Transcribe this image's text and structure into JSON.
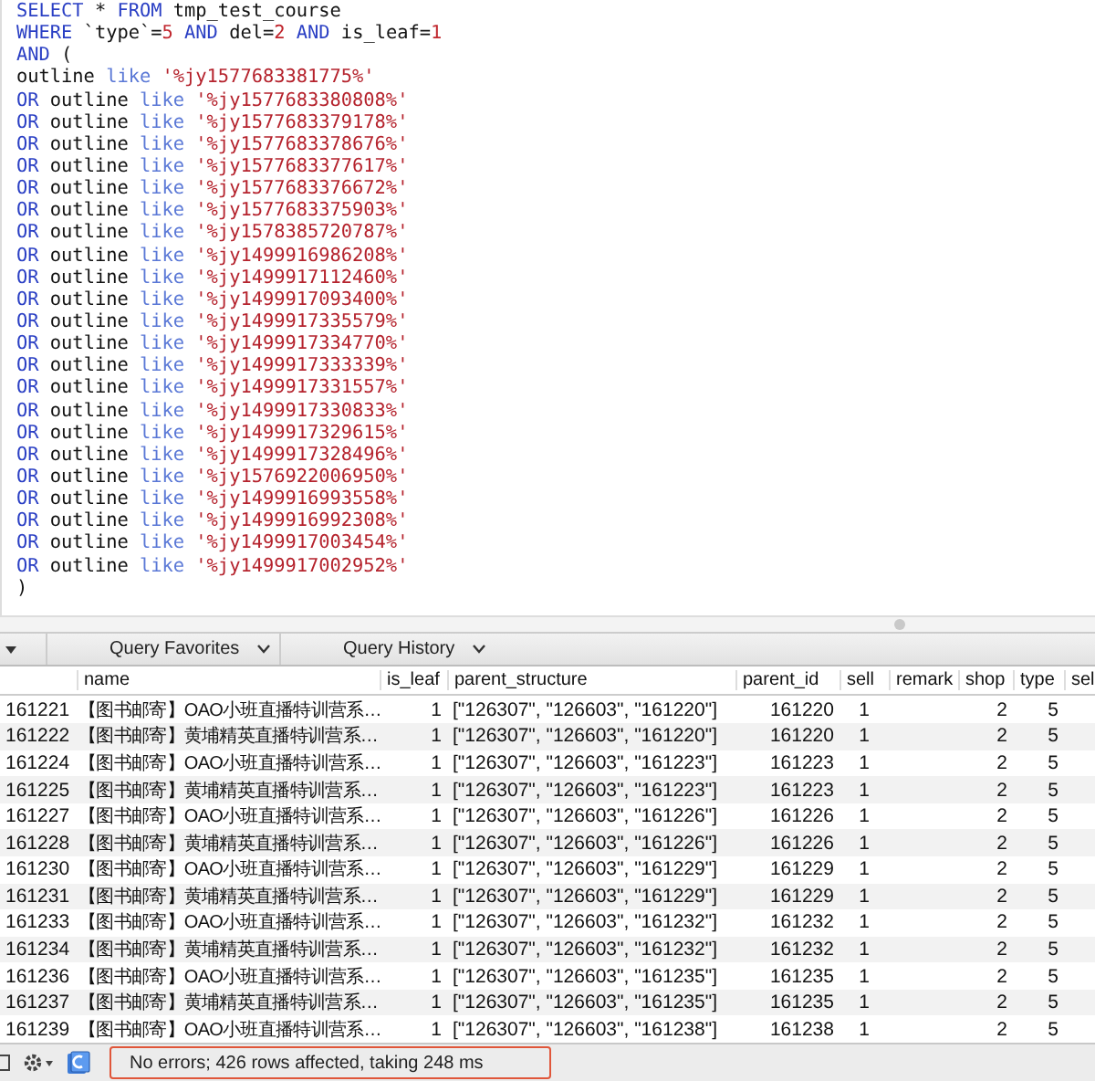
{
  "editor": {
    "lines": [
      [
        {
          "kind": "keyword",
          "text": "SELECT"
        },
        {
          "kind": "plain",
          "text": " * "
        },
        {
          "kind": "keyword",
          "text": "FROM"
        },
        {
          "kind": "plain",
          "text": " tmp_test_course"
        }
      ],
      [
        {
          "kind": "keyword",
          "text": "WHERE"
        },
        {
          "kind": "plain",
          "text": " `type`="
        },
        {
          "kind": "number",
          "text": "5"
        },
        {
          "kind": "keyword",
          "text": " AND"
        },
        {
          "kind": "plain",
          "text": " del="
        },
        {
          "kind": "number",
          "text": "2"
        },
        {
          "kind": "keyword",
          "text": " AND"
        },
        {
          "kind": "plain",
          "text": " is_leaf="
        },
        {
          "kind": "number",
          "text": "1"
        }
      ],
      [
        {
          "kind": "keyword",
          "text": "AND"
        },
        {
          "kind": "plain",
          "text": " ("
        }
      ],
      [
        {
          "kind": "plain",
          "text": "outline "
        },
        {
          "kind": "operator",
          "text": "like"
        },
        {
          "kind": "string",
          "text": " '%jy1577683381775%'"
        }
      ],
      [
        {
          "kind": "keyword",
          "text": "OR"
        },
        {
          "kind": "plain",
          "text": " outline "
        },
        {
          "kind": "operator",
          "text": "like"
        },
        {
          "kind": "string",
          "text": " '%jy1577683380808%'"
        }
      ],
      [
        {
          "kind": "keyword",
          "text": "OR"
        },
        {
          "kind": "plain",
          "text": " outline "
        },
        {
          "kind": "operator",
          "text": "like"
        },
        {
          "kind": "string",
          "text": " '%jy1577683379178%'"
        }
      ],
      [
        {
          "kind": "keyword",
          "text": "OR"
        },
        {
          "kind": "plain",
          "text": " outline "
        },
        {
          "kind": "operator",
          "text": "like"
        },
        {
          "kind": "string",
          "text": " '%jy1577683378676%'"
        }
      ],
      [
        {
          "kind": "keyword",
          "text": "OR"
        },
        {
          "kind": "plain",
          "text": " outline "
        },
        {
          "kind": "operator",
          "text": "like"
        },
        {
          "kind": "string",
          "text": " '%jy1577683377617%'"
        }
      ],
      [
        {
          "kind": "keyword",
          "text": "OR"
        },
        {
          "kind": "plain",
          "text": " outline "
        },
        {
          "kind": "operator",
          "text": "like"
        },
        {
          "kind": "string",
          "text": " '%jy1577683376672%'"
        }
      ],
      [
        {
          "kind": "keyword",
          "text": "OR"
        },
        {
          "kind": "plain",
          "text": " outline "
        },
        {
          "kind": "operator",
          "text": "like"
        },
        {
          "kind": "string",
          "text": " '%jy1577683375903%'"
        }
      ],
      [
        {
          "kind": "keyword",
          "text": "OR"
        },
        {
          "kind": "plain",
          "text": " outline "
        },
        {
          "kind": "operator",
          "text": "like"
        },
        {
          "kind": "string",
          "text": " '%jy1578385720787%'"
        }
      ],
      [
        {
          "kind": "keyword",
          "text": "OR"
        },
        {
          "kind": "plain",
          "text": " outline "
        },
        {
          "kind": "operator",
          "text": "like"
        },
        {
          "kind": "string",
          "text": " '%jy1499916986208%'"
        }
      ],
      [
        {
          "kind": "keyword",
          "text": "OR"
        },
        {
          "kind": "plain",
          "text": " outline "
        },
        {
          "kind": "operator",
          "text": "like"
        },
        {
          "kind": "string",
          "text": " '%jy1499917112460%'"
        }
      ],
      [
        {
          "kind": "keyword",
          "text": "OR"
        },
        {
          "kind": "plain",
          "text": " outline "
        },
        {
          "kind": "operator",
          "text": "like"
        },
        {
          "kind": "string",
          "text": " '%jy1499917093400%'"
        }
      ],
      [
        {
          "kind": "keyword",
          "text": "OR"
        },
        {
          "kind": "plain",
          "text": " outline "
        },
        {
          "kind": "operator",
          "text": "like"
        },
        {
          "kind": "string",
          "text": " '%jy1499917335579%'"
        }
      ],
      [
        {
          "kind": "keyword",
          "text": "OR"
        },
        {
          "kind": "plain",
          "text": " outline "
        },
        {
          "kind": "operator",
          "text": "like"
        },
        {
          "kind": "string",
          "text": " '%jy1499917334770%'"
        }
      ],
      [
        {
          "kind": "keyword",
          "text": "OR"
        },
        {
          "kind": "plain",
          "text": " outline "
        },
        {
          "kind": "operator",
          "text": "like"
        },
        {
          "kind": "string",
          "text": " '%jy1499917333339%'"
        }
      ],
      [
        {
          "kind": "keyword",
          "text": "OR"
        },
        {
          "kind": "plain",
          "text": " outline "
        },
        {
          "kind": "operator",
          "text": "like"
        },
        {
          "kind": "string",
          "text": " '%jy1499917331557%'"
        }
      ],
      [
        {
          "kind": "keyword",
          "text": "OR"
        },
        {
          "kind": "plain",
          "text": " outline "
        },
        {
          "kind": "operator",
          "text": "like"
        },
        {
          "kind": "string",
          "text": " '%jy1499917330833%'"
        }
      ],
      [
        {
          "kind": "keyword",
          "text": "OR"
        },
        {
          "kind": "plain",
          "text": " outline "
        },
        {
          "kind": "operator",
          "text": "like"
        },
        {
          "kind": "string",
          "text": " '%jy1499917329615%'"
        }
      ],
      [
        {
          "kind": "keyword",
          "text": "OR"
        },
        {
          "kind": "plain",
          "text": " outline "
        },
        {
          "kind": "operator",
          "text": "like"
        },
        {
          "kind": "string",
          "text": " '%jy1499917328496%'"
        }
      ],
      [
        {
          "kind": "keyword",
          "text": "OR"
        },
        {
          "kind": "plain",
          "text": " outline "
        },
        {
          "kind": "operator",
          "text": "like"
        },
        {
          "kind": "string",
          "text": " '%jy1576922006950%'"
        }
      ],
      [
        {
          "kind": "keyword",
          "text": "OR"
        },
        {
          "kind": "plain",
          "text": " outline "
        },
        {
          "kind": "operator",
          "text": "like"
        },
        {
          "kind": "string",
          "text": " '%jy1499916993558%'"
        }
      ],
      [
        {
          "kind": "keyword",
          "text": "OR"
        },
        {
          "kind": "plain",
          "text": " outline "
        },
        {
          "kind": "operator",
          "text": "like"
        },
        {
          "kind": "string",
          "text": " '%jy1499916992308%'"
        }
      ],
      [
        {
          "kind": "keyword",
          "text": "OR"
        },
        {
          "kind": "plain",
          "text": " outline "
        },
        {
          "kind": "operator",
          "text": "like"
        },
        {
          "kind": "string",
          "text": " '%jy1499917003454%'"
        }
      ],
      [
        {
          "kind": "keyword",
          "text": "OR"
        },
        {
          "kind": "plain",
          "text": " outline "
        },
        {
          "kind": "operator",
          "text": "like"
        },
        {
          "kind": "string",
          "text": " '%jy1499917002952%'"
        }
      ],
      [
        {
          "kind": "plain",
          "text": ")"
        }
      ]
    ]
  },
  "toolbar": {
    "buttons": [
      "Query Favorites",
      "Query History"
    ]
  },
  "table": {
    "columns": [
      null,
      "name",
      "is_leaf",
      "parent_structure",
      "parent_id",
      "sell",
      "remark",
      "shop",
      "type",
      "sel"
    ],
    "rows": [
      [
        "161221",
        "【图书邮寄】OAO小班直播特训营系…",
        "1",
        "[\"126307\", \"126603\", \"161220\"]",
        "161220",
        "1",
        null,
        "2",
        "5"
      ],
      [
        "161222",
        "【图书邮寄】黄埔精英直播特训营系…",
        "1",
        "[\"126307\", \"126603\", \"161220\"]",
        "161220",
        "1",
        null,
        "2",
        "5"
      ],
      [
        "161224",
        "【图书邮寄】OAO小班直播特训营系…",
        "1",
        "[\"126307\", \"126603\", \"161223\"]",
        "161223",
        "1",
        null,
        "2",
        "5"
      ],
      [
        "161225",
        "【图书邮寄】黄埔精英直播特训营系…",
        "1",
        "[\"126307\", \"126603\", \"161223\"]",
        "161223",
        "1",
        null,
        "2",
        "5"
      ],
      [
        "161227",
        "【图书邮寄】OAO小班直播特训营系…",
        "1",
        "[\"126307\", \"126603\", \"161226\"]",
        "161226",
        "1",
        null,
        "2",
        "5"
      ],
      [
        "161228",
        "【图书邮寄】黄埔精英直播特训营系…",
        "1",
        "[\"126307\", \"126603\", \"161226\"]",
        "161226",
        "1",
        null,
        "2",
        "5"
      ],
      [
        "161230",
        "【图书邮寄】OAO小班直播特训营系…",
        "1",
        "[\"126307\", \"126603\", \"161229\"]",
        "161229",
        "1",
        null,
        "2",
        "5"
      ],
      [
        "161231",
        "【图书邮寄】黄埔精英直播特训营系…",
        "1",
        "[\"126307\", \"126603\", \"161229\"]",
        "161229",
        "1",
        null,
        "2",
        "5"
      ],
      [
        "161233",
        "【图书邮寄】OAO小班直播特训营系…",
        "1",
        "[\"126307\", \"126603\", \"161232\"]",
        "161232",
        "1",
        null,
        "2",
        "5"
      ],
      [
        "161234",
        "【图书邮寄】黄埔精英直播特训营系…",
        "1",
        "[\"126307\", \"126603\", \"161232\"]",
        "161232",
        "1",
        null,
        "2",
        "5"
      ],
      [
        "161236",
        "【图书邮寄】OAO小班直播特训营系…",
        "1",
        "[\"126307\", \"126603\", \"161235\"]",
        "161235",
        "1",
        null,
        "2",
        "5"
      ],
      [
        "161237",
        "【图书邮寄】黄埔精英直播特训营系…",
        "1",
        "[\"126307\", \"126603\", \"161235\"]",
        "161235",
        "1",
        null,
        "2",
        "5"
      ],
      [
        "161239",
        "【图书邮寄】OAO小班直播特训营系…",
        "1",
        "[\"126307\", \"126603\", \"161238\"]",
        "161238",
        "1",
        null,
        "2",
        "5"
      ]
    ]
  },
  "status_bar": {
    "message": "No errors; 426 rows affected, taking 248 ms"
  }
}
